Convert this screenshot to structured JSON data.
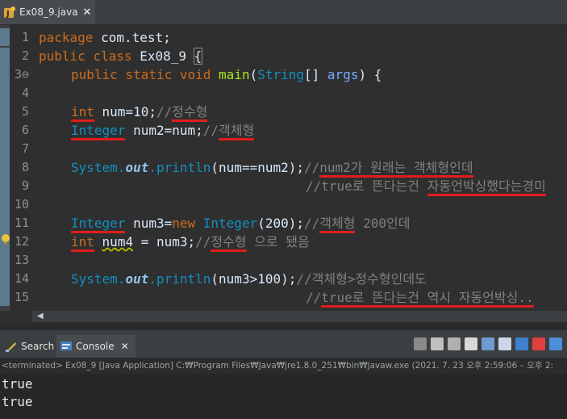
{
  "editor_tab": {
    "label": "Ex08_9.java",
    "close": "✕"
  },
  "code_lines": [
    {
      "n": "1"
    },
    {
      "n": "2"
    },
    {
      "n": "3⊖"
    },
    {
      "n": "4"
    },
    {
      "n": "5"
    },
    {
      "n": "6"
    },
    {
      "n": "7"
    },
    {
      "n": "8"
    },
    {
      "n": "9"
    },
    {
      "n": "10"
    },
    {
      "n": "11"
    },
    {
      "n": "12"
    },
    {
      "n": "13"
    },
    {
      "n": "14"
    },
    {
      "n": "15"
    }
  ],
  "code": {
    "l1_kw": "package",
    "l1_rest": " com.test;",
    "l2_kw1": "public",
    "l2_kw2": "class",
    "l2_name": " Ex08_9 ",
    "l2_brace": "{",
    "l3_kw1": "public",
    "l3_kw2": "static",
    "l3_kw3": "void",
    "l3_method": "main",
    "l3_p1": "(",
    "l3_type": "String",
    "l3_p2": "[] ",
    "l3_arg": "args",
    "l3_p3": ") {",
    "l5_type": "int",
    "l5_rest": " num=10;",
    "l5_cm1": "//",
    "l5_cm2": "정수형",
    "l6_type": "Integer",
    "l6_rest": " num2=num;",
    "l6_cm1": "//",
    "l6_cm2": "객체형",
    "l8_sys": "System.",
    "l8_out": "out",
    "l8_m": ".println",
    "l8_rest": "(num==num2);",
    "l8_cm1": "//",
    "l8_cm2": "num2가 원래는 객체형인데",
    "l9_cm1": "//true로 뜬다는건 ",
    "l9_cm2": "자동언박싱했다는경미",
    "l11_type": "Integer",
    "l11_rest1": " num3=",
    "l11_new": "new",
    "l11_type2": " Integer",
    "l11_rest2": "(200);",
    "l11_cm1": "//",
    "l11_cm2": "객체형",
    "l11_cm3": " 200인데",
    "l12_type": "int",
    "l12_sp": " ",
    "l12_var": "num4",
    "l12_rest": " = num3;",
    "l12_cm1": "//",
    "l12_cm2": "정수형",
    "l12_cm3": " 으로 됐음",
    "l14_sys": "System.",
    "l14_out": "out",
    "l14_m": ".println",
    "l14_rest": "(num3>100);",
    "l14_cm": "//객체형>정수형인데도",
    "l15_cm1": "//",
    "l15_cm2": "true로 뜬다는건 역시 자동언박싱.."
  },
  "console_tabs": {
    "search": "Search",
    "console": "Console",
    "close": "✕"
  },
  "status": "<terminated> Ex08_9 [Java Application] C:₩Program Files₩Java₩jre1.8.0_251₩bin₩javaw.exe  (2021. 7. 23 오후 2:59:06 – 오후 2:",
  "output": [
    "true",
    "true"
  ],
  "colors": {
    "underline": "#e31c1c",
    "keyword": "#cc6c1d",
    "type": "#1290c3",
    "comment": "#808080"
  }
}
